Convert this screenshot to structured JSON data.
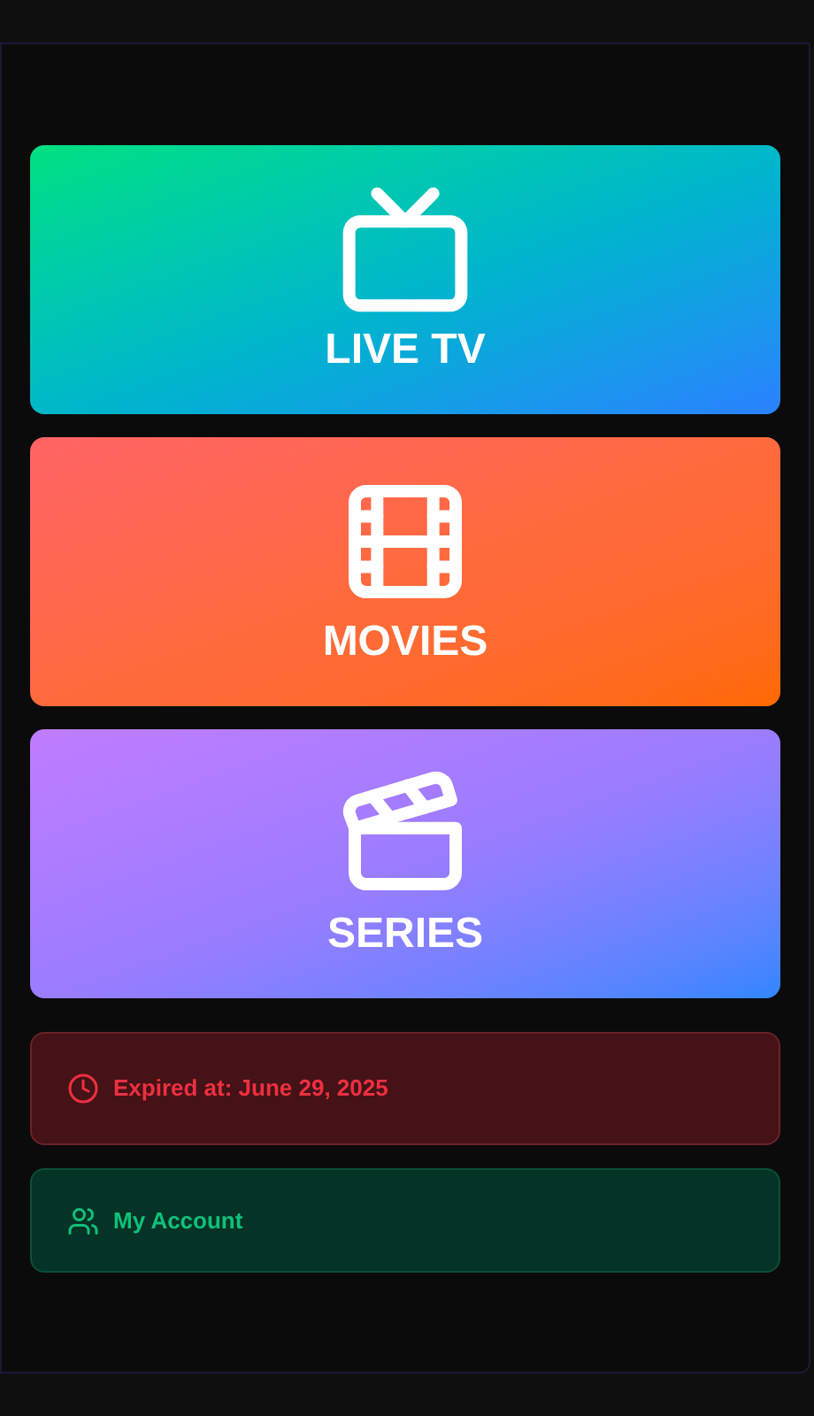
{
  "categories": [
    {
      "kind": "live",
      "label": "LIVE TV"
    },
    {
      "kind": "movies",
      "label": "MOVIES"
    },
    {
      "kind": "series",
      "label": "SERIES"
    }
  ],
  "expiry": {
    "text": "Expired at: June 29, 2025"
  },
  "account": {
    "label": "My Account"
  }
}
